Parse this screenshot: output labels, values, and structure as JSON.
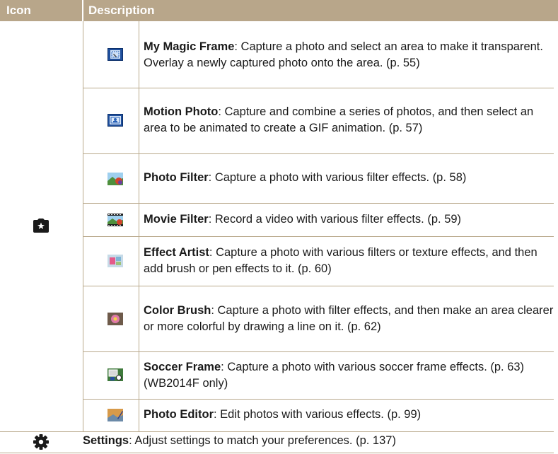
{
  "header": {
    "col_icon": "Icon",
    "col_description": "Description"
  },
  "modes": [
    {
      "title": "My Magic Frame",
      "text": ": Capture a photo and select an area to make it transparent. Overlay a newly captured photo onto the area. (p. 55)",
      "icon": "my-magic-frame-icon"
    },
    {
      "title": "Motion Photo",
      "text": ": Capture and combine a series of photos, and then select an area to be animated to create a GIF animation. (p. 57)",
      "icon": "motion-photo-icon"
    },
    {
      "title": "Photo Filter",
      "text": ": Capture a photo with various filter effects. (p. 58)",
      "icon": "photo-filter-icon"
    },
    {
      "title": "Movie Filter",
      "text": ": Record a video with various filter effects. (p. 59)",
      "icon": "movie-filter-icon"
    },
    {
      "title": "Effect Artist",
      "text": ": Capture a photo with various filters or texture effects, and then add brush or pen effects to it. (p. 60)",
      "icon": "effect-artist-icon"
    },
    {
      "title": "Color Brush",
      "text": ": Capture a photo with filter effects, and then make an area clearer or more colorful by drawing a line on it. (p. 62)",
      "icon": "color-brush-icon"
    },
    {
      "title": "Soccer Frame",
      "text": ":  Capture a photo with various soccer frame effects. (p. 63) (WB2014F only)",
      "icon": "soccer-frame-icon"
    },
    {
      "title": "Photo Editor",
      "text": ": Edit photos with various effects. (p. 99)",
      "icon": "photo-editor-icon"
    }
  ],
  "settings": {
    "title": "Settings",
    "text": ": Adjust settings to match your preferences. (p. 137)",
    "icon": "settings-gear-icon"
  },
  "group_icon": "camera-star-icon",
  "colors": {
    "header_bg": "#b8a68a",
    "rule": "#b9a98c"
  }
}
